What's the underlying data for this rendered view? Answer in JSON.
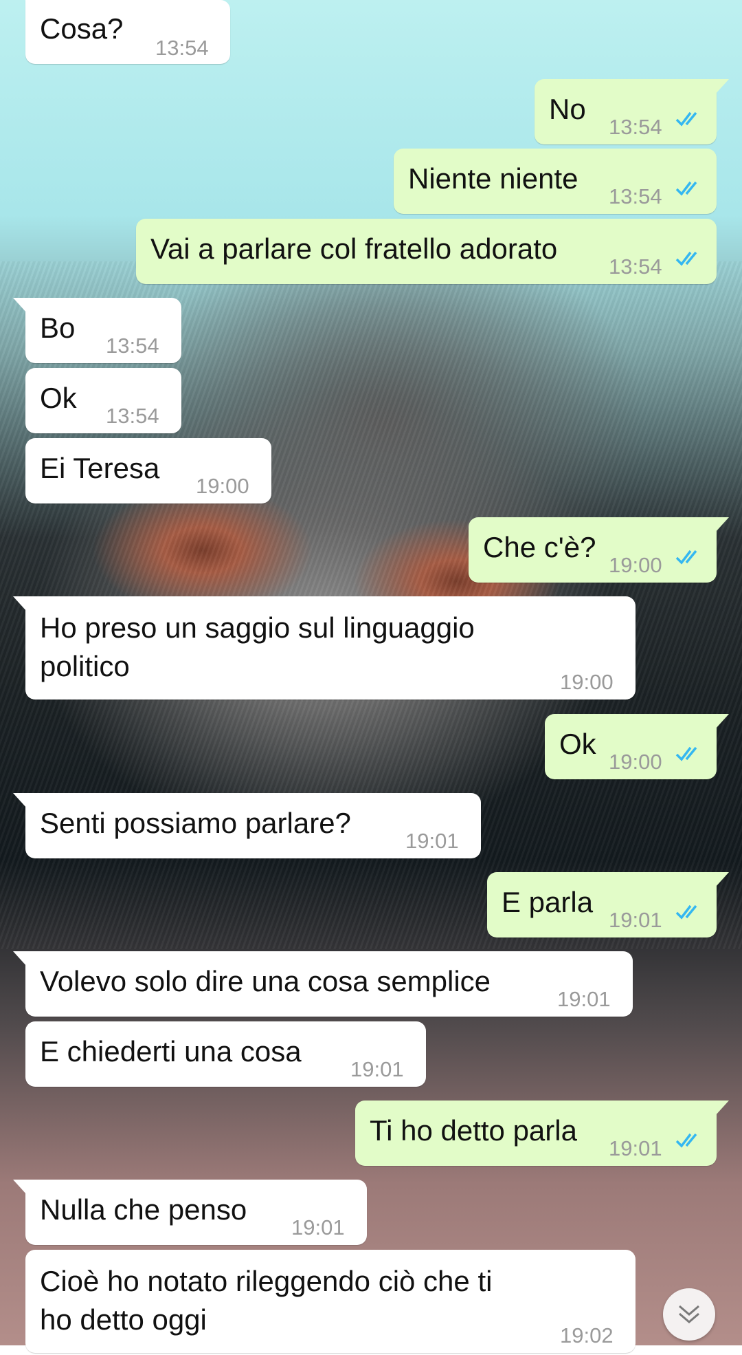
{
  "messages": [
    {
      "dir": "in",
      "text": "Cosa?",
      "time": "13:54"
    },
    {
      "dir": "out",
      "text": "No",
      "time": "13:54"
    },
    {
      "dir": "out",
      "text": "Niente niente",
      "time": "13:54"
    },
    {
      "dir": "out",
      "text": "Vai a parlare col fratello adorato",
      "time": "13:54"
    },
    {
      "dir": "in",
      "text": "Bo",
      "time": "13:54"
    },
    {
      "dir": "in",
      "text": "Ok",
      "time": "13:54"
    },
    {
      "dir": "in",
      "text": "Ei Teresa",
      "time": "19:00"
    },
    {
      "dir": "out",
      "text": "Che c'è?",
      "time": "19:00"
    },
    {
      "dir": "in",
      "text": "Ho preso un saggio sul linguaggio politico",
      "time": "19:00"
    },
    {
      "dir": "out",
      "text": "Ok",
      "time": "19:00"
    },
    {
      "dir": "in",
      "text": "Senti possiamo parlare?",
      "time": "19:01"
    },
    {
      "dir": "out",
      "text": "E parla",
      "time": "19:01"
    },
    {
      "dir": "in",
      "text": "Volevo solo dire una cosa semplice",
      "time": "19:01"
    },
    {
      "dir": "in",
      "text": "E chiederti una cosa",
      "time": "19:01"
    },
    {
      "dir": "out",
      "text": "Ti ho detto parla",
      "time": "19:01"
    },
    {
      "dir": "in",
      "text": "Nulla che penso",
      "time": "19:01"
    },
    {
      "dir": "in",
      "text": "Cioè ho notato rileggendo ciò che ti ho detto oggi",
      "time": "19:02"
    }
  ],
  "read_receipt_icon": "double-check-icon",
  "scroll_button_icon": "double-chevron-down-icon",
  "colors": {
    "incoming_bubble": "#ffffff",
    "outgoing_bubble": "#e2fcc8",
    "read_receipt": "#34b7f1",
    "timestamp": "#9a9a9a"
  }
}
